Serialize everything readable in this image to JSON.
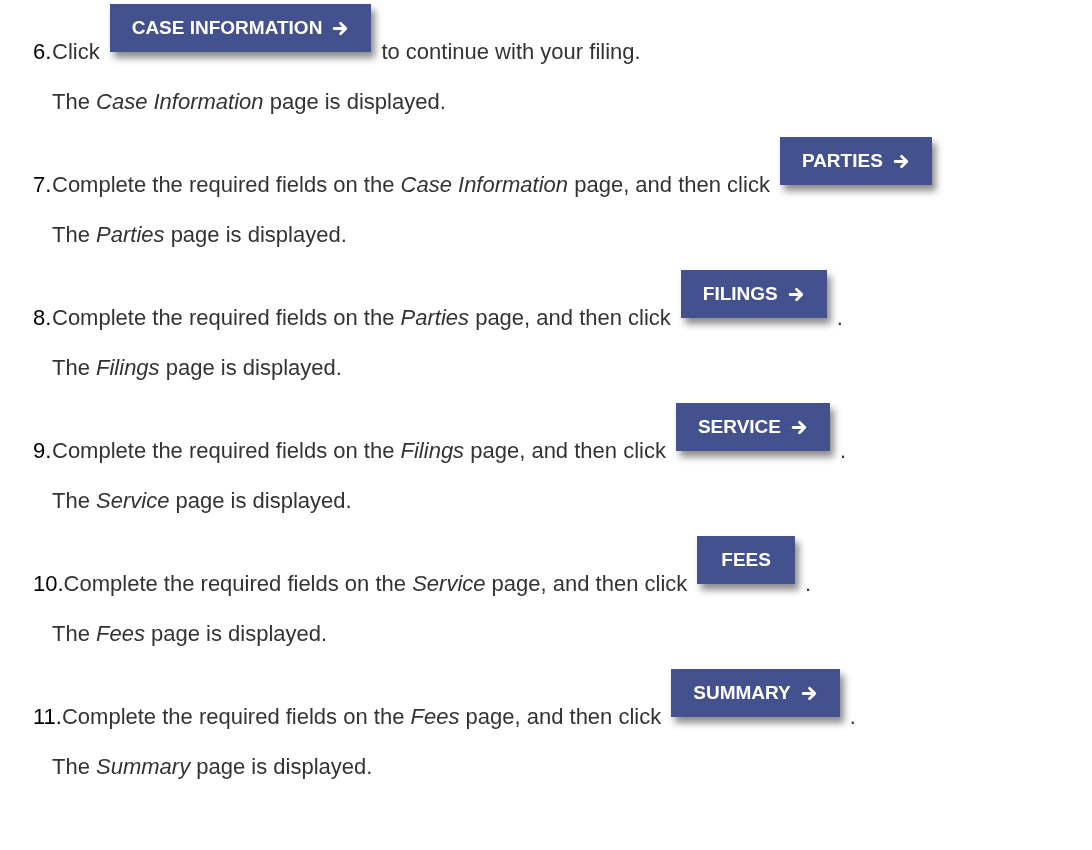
{
  "steps": [
    {
      "number": "6.",
      "before": "Click",
      "button": {
        "label": "CASE INFORMATION",
        "arrow": true
      },
      "after": "to continue with your filing.",
      "result": "The *Case Information* page is displayed."
    },
    {
      "number": "7.",
      "before": "Complete the required fields on the *Case Information* page, and then click",
      "button": {
        "label": "PARTIES",
        "arrow": true
      },
      "result": "The *Parties* page is displayed."
    },
    {
      "number": "8.",
      "before": "Complete the required fields on the *Parties* page, and then click",
      "button": {
        "label": "FILINGS",
        "arrow": true
      },
      "after": ".",
      "result": "The *Filings* page is displayed."
    },
    {
      "number": "9.",
      "before": "Complete the required fields on the *Filings* page, and then click",
      "button": {
        "label": "SERVICE",
        "arrow": true
      },
      "after": ".",
      "result": "The *Service* page is displayed."
    },
    {
      "number": "10.",
      "before": "Complete the required fields on the *Service* page, and then click",
      "button": {
        "label": "FEES",
        "arrow": false
      },
      "after": ".",
      "result": "The *Fees* page is displayed."
    },
    {
      "number": "11.",
      "before": "Complete the required fields on the *Fees* page, and then click",
      "button": {
        "label": "SUMMARY",
        "arrow": true
      },
      "after": ".",
      "result": "The *Summary* page is displayed."
    }
  ]
}
